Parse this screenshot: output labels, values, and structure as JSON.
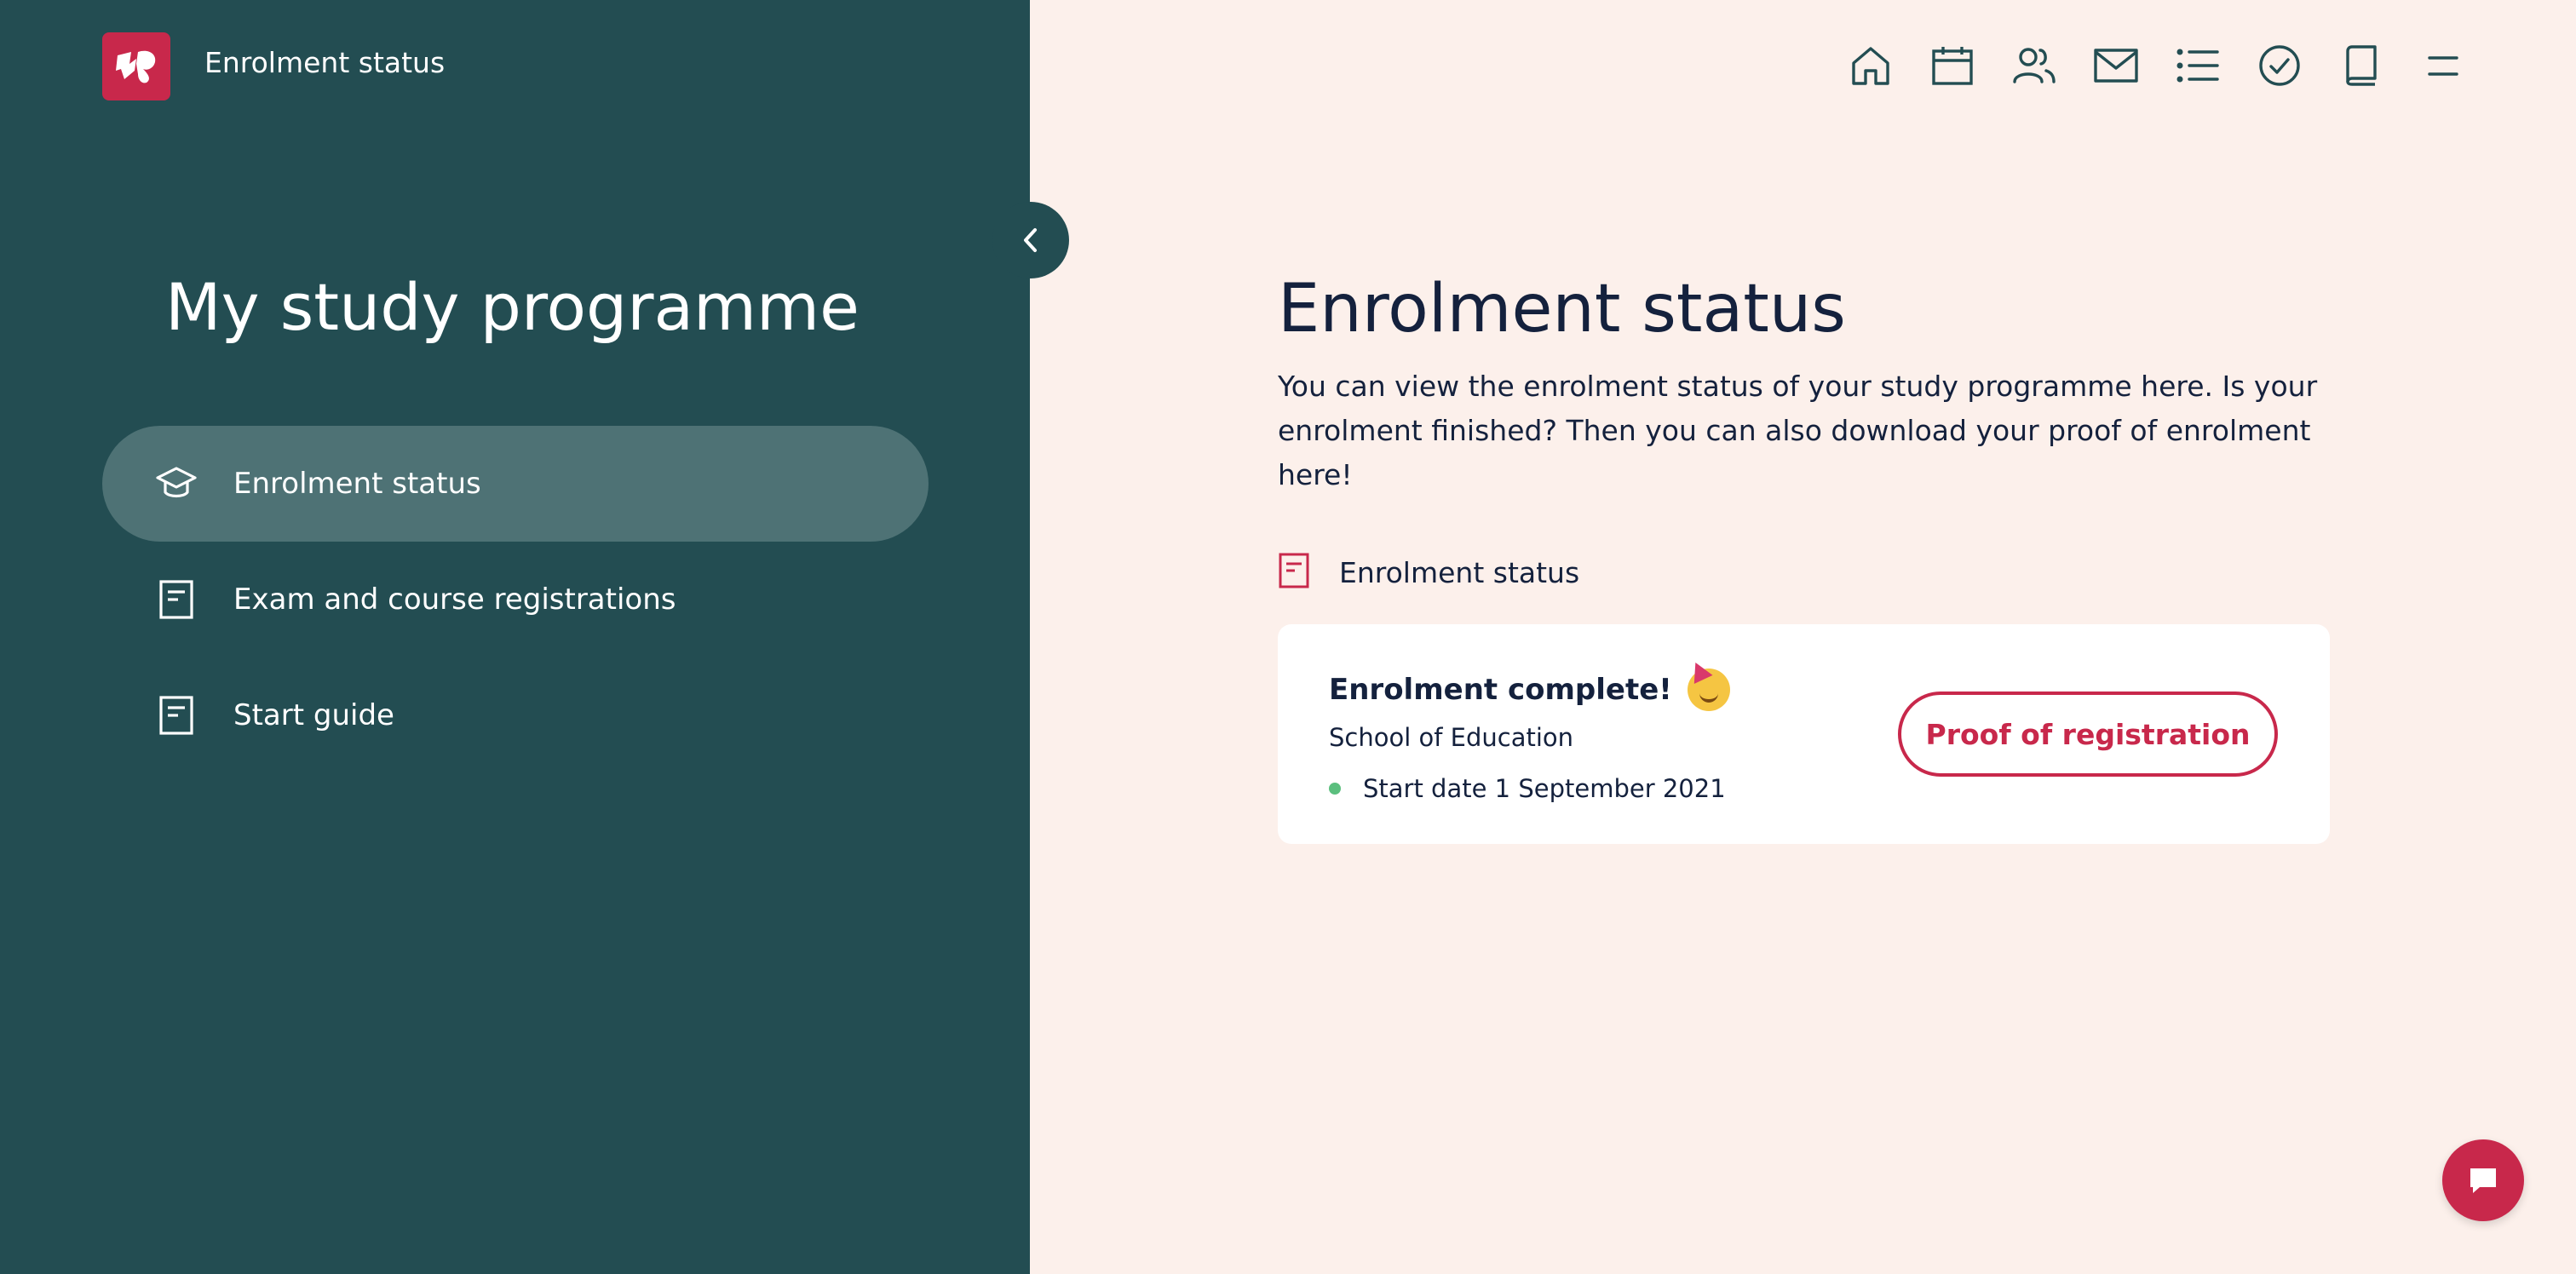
{
  "header": {
    "app_title": "Enrolment status",
    "logo_icon": "university-logo-icon",
    "nav_icons": [
      "home-icon",
      "calendar-icon",
      "people-icon",
      "mail-icon",
      "list-icon",
      "check-circle-icon",
      "book-icon",
      "menu-icon"
    ]
  },
  "sidebar": {
    "title": "My study programme",
    "items": [
      {
        "label": "Enrolment status",
        "icon": "graduation-cap-icon",
        "active": true
      },
      {
        "label": "Exam and course registrations",
        "icon": "document-icon",
        "active": false
      },
      {
        "label": "Start guide",
        "icon": "document-icon",
        "active": false
      }
    ]
  },
  "main": {
    "title": "Enrolment status",
    "description": "You can view the enrolment status of your study programme here. Is your enrolment finished? Then you can also download your proof of enrolment here!",
    "section_label": "Enrolment status",
    "card": {
      "title": "Enrolment complete!",
      "school": "School of Education",
      "start_date": "Start date 1 September 2021",
      "button_label": "Proof of registration"
    }
  },
  "colors": {
    "sidebar_bg": "#234d52",
    "active_item_bg": "#4e7275",
    "page_bg": "#fcf0eb",
    "accent": "#c8284b",
    "text_dark": "#14213d",
    "status_green": "#5bbf7e"
  }
}
